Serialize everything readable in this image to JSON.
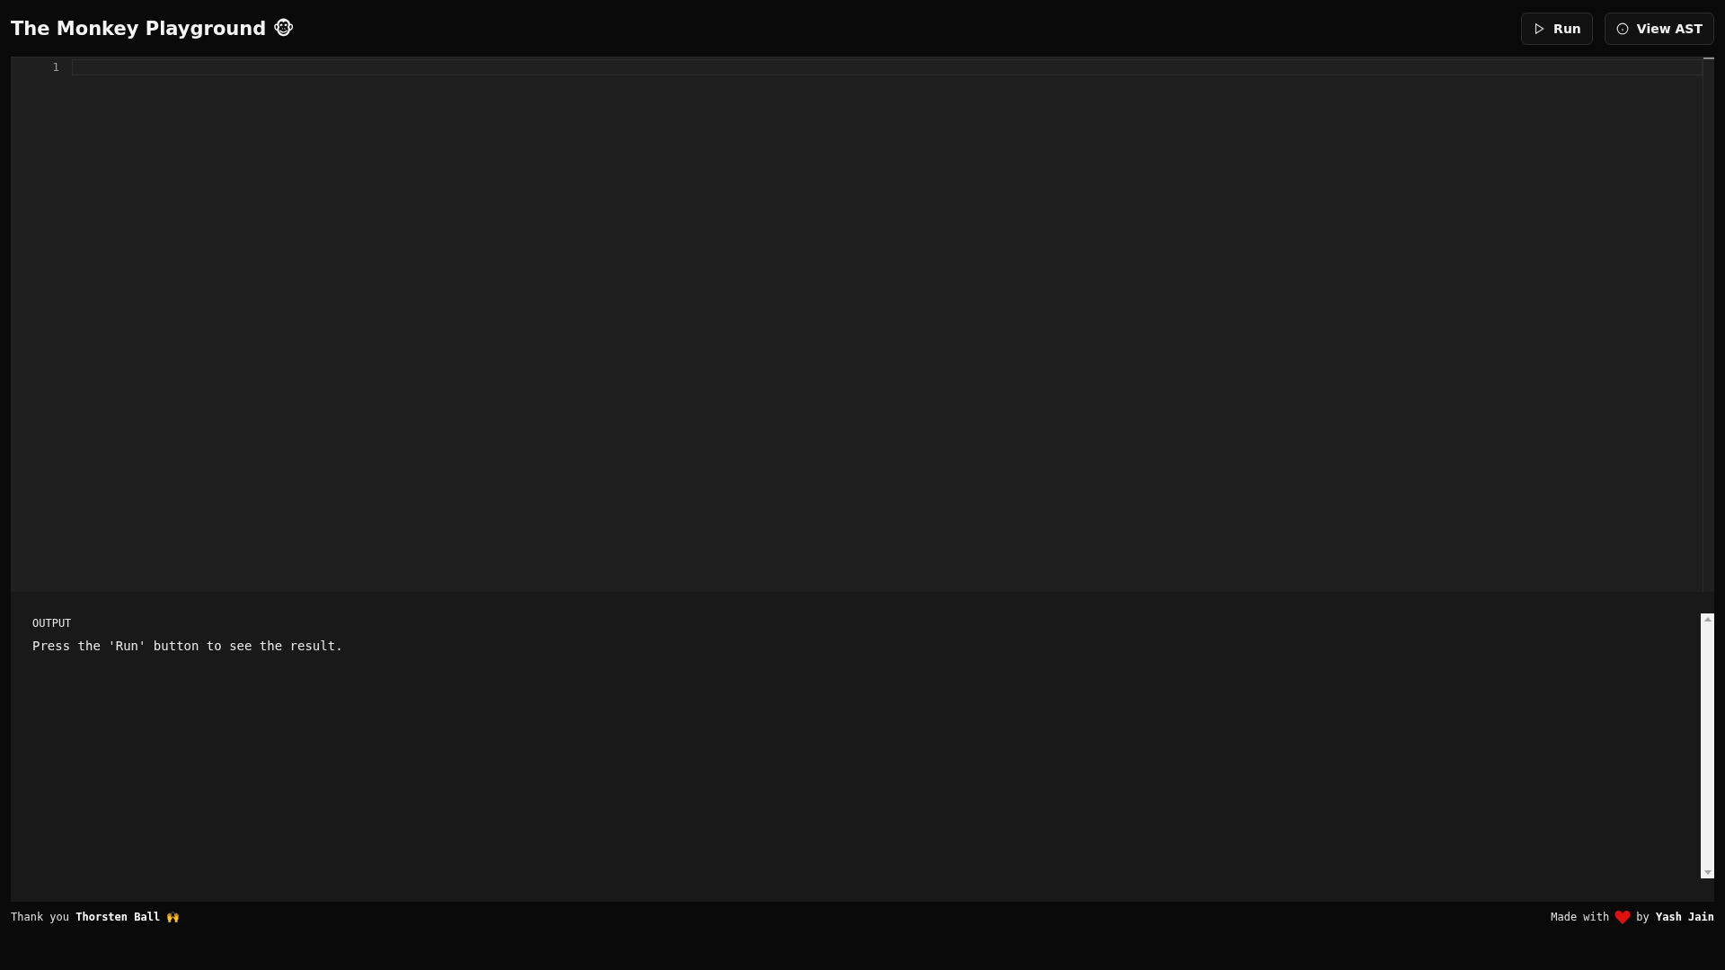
{
  "header": {
    "title": "The Monkey Playground 🐵",
    "buttons": [
      {
        "kind": "run",
        "label": "Run"
      },
      {
        "kind": "info",
        "label": "View AST"
      }
    ]
  },
  "editor": {
    "line_numbers": [
      "1"
    ]
  },
  "output": {
    "label": "OUTPUT",
    "text": "Press the 'Run' button to see the result."
  },
  "footer": {
    "credit": "Thank you **Thorsten Ball** 🙌",
    "made_with": "Made with",
    "by": "by **Yash Jain**"
  }
}
